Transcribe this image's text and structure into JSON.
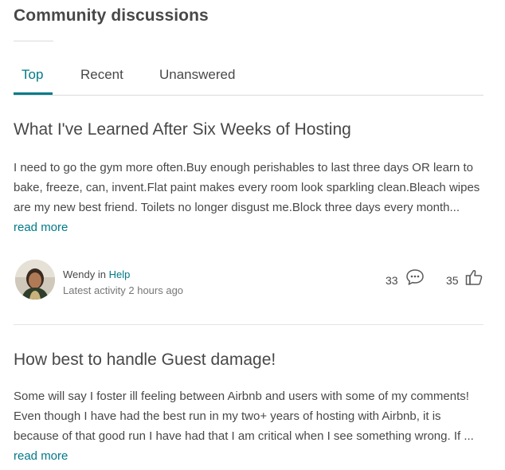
{
  "section": {
    "title": "Community discussions"
  },
  "tabs": [
    {
      "label": "Top",
      "active": true
    },
    {
      "label": "Recent",
      "active": false
    },
    {
      "label": "Unanswered",
      "active": false
    }
  ],
  "posts": [
    {
      "title": "What I've Learned After Six Weeks of Hosting",
      "body": "I need to go the gym more often.Buy enough perishables to last three days OR learn to bake, freeze, can, invent.Flat paint makes every room look sparkling clean.Bleach wipes are my new best friend. Toilets no longer disgust me.Block three days every month...",
      "read_more": "read more",
      "author": "Wendy",
      "in_word": "in",
      "board": "Help",
      "activity": "Latest activity 2 hours ago",
      "replies": "33",
      "kudos": "35"
    },
    {
      "title": "How best to handle Guest damage!",
      "body": "Some will say I foster ill feeling between Airbnb and users with some of my comments! Even though I have had the best run in my two+ years of hosting with Airbnb, it is because of that good run I have had that I am critical when I see something wrong. If ...",
      "read_more": "read more"
    }
  ],
  "colors": {
    "accent": "#007a87",
    "text": "#484848",
    "muted": "#767676",
    "divider": "#dbdbdb"
  },
  "icons": {
    "replies": "speech-bubble-icon",
    "kudos": "thumbs-up-icon"
  }
}
